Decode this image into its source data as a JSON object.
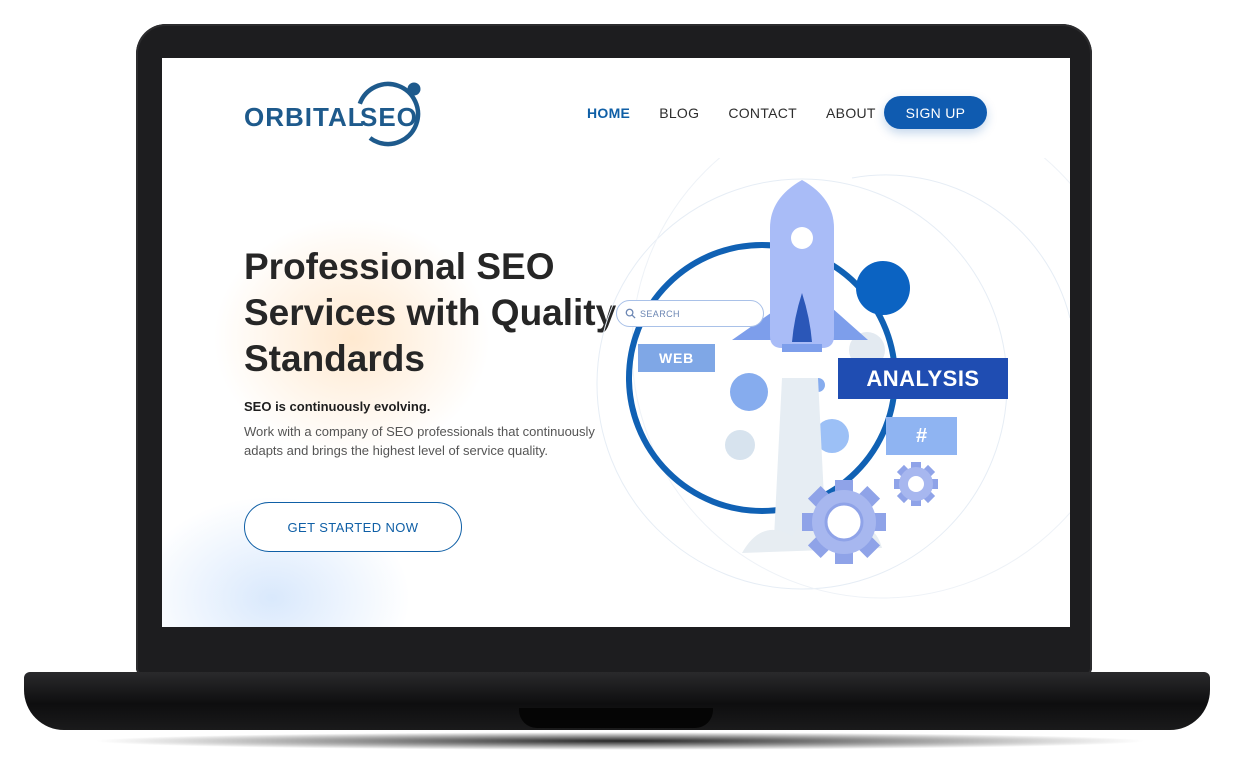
{
  "logo": {
    "word1": "ORBITAL",
    "word2": "SEO"
  },
  "nav": {
    "items": [
      {
        "label": "HOME",
        "active": true
      },
      {
        "label": "BLOG",
        "active": false
      },
      {
        "label": "CONTACT",
        "active": false
      },
      {
        "label": "ABOUT",
        "active": false
      }
    ],
    "signup_label": "SIGN UP"
  },
  "hero": {
    "title": "Professional SEO Services with Quality Standards",
    "subtitle": "SEO is continuously evolving.",
    "body": "Work with a company of SEO professionals that continuously adapts and brings the highest level of service quality.",
    "cta_label": "GET STARTED NOW"
  },
  "illustration": {
    "search_placeholder": "SEARCH",
    "tags": {
      "web": "WEB",
      "analysis": "ANALYSIS",
      "hash": "#"
    }
  },
  "colors": {
    "brand": "#0f5fa6",
    "button": "#0f5bb0",
    "heading": "#262626",
    "analysis_tag": "#1f4db2",
    "web_tag": "#7fa7e6",
    "hash_tag": "#8fb4f2"
  }
}
